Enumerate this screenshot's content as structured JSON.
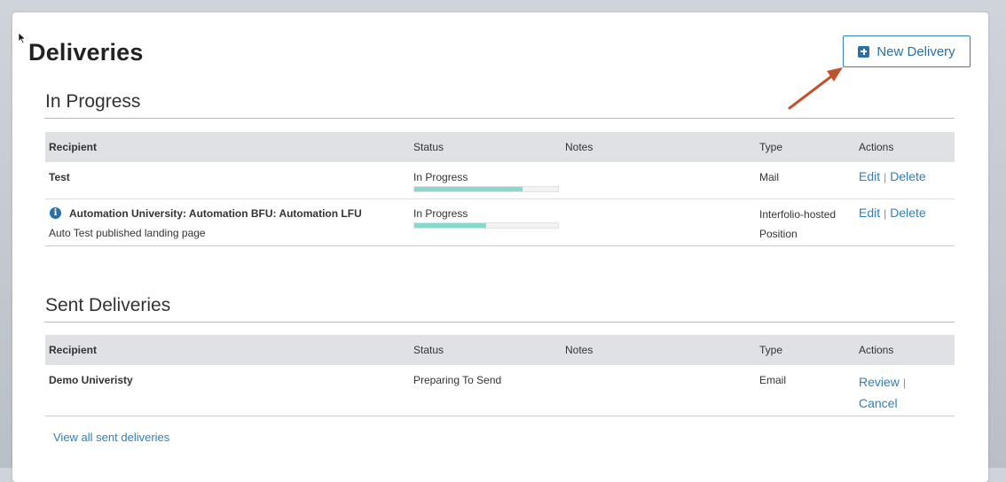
{
  "page": {
    "title": "Deliveries",
    "new_button_label": "New Delivery"
  },
  "in_progress": {
    "section_title": "In Progress",
    "columns": [
      "Recipient",
      "Status",
      "Notes",
      "Type",
      "Actions"
    ],
    "rows": [
      {
        "recipient": "Test",
        "recipient_sub": "",
        "status": "In Progress",
        "progress_percent": 75,
        "notes": "",
        "type": "Mail",
        "actions": [
          "Edit",
          "Delete"
        ]
      },
      {
        "recipient": "Automation University: Automation BFU: Automation LFU",
        "recipient_sub": "Auto Test published landing page",
        "status": "In Progress",
        "progress_percent": 50,
        "notes": "",
        "type": "Interfolio-hosted Position",
        "actions": [
          "Edit",
          "Delete"
        ]
      }
    ]
  },
  "sent": {
    "section_title": "Sent Deliveries",
    "columns": [
      "Recipient",
      "Status",
      "Notes",
      "Type",
      "Actions"
    ],
    "rows": [
      {
        "recipient": "Demo Univeristy",
        "status": "Preparing To Send",
        "notes": "",
        "type": "Email",
        "actions": [
          "Review",
          "Cancel"
        ]
      }
    ],
    "view_all_label": "View all sent deliveries"
  },
  "colors": {
    "accent": "#2f7fb8",
    "progress": "#88d9cc",
    "header_bg": "#dfe1e4",
    "annotation_arrow": "#c0532f"
  }
}
